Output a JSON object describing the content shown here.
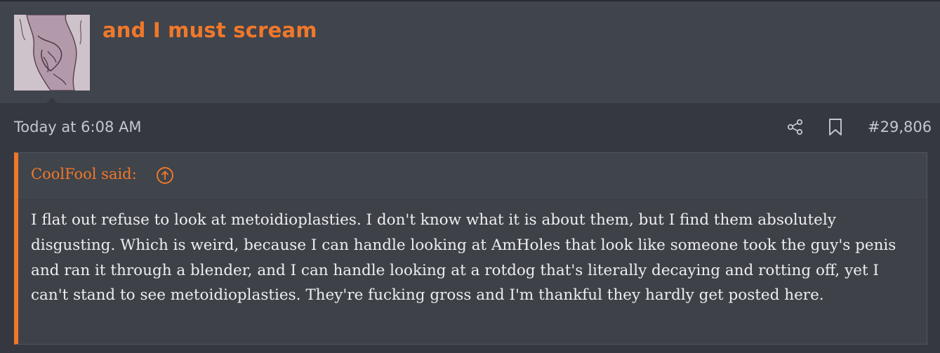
{
  "post": {
    "username": "and I must scream",
    "timestamp": "Today at 6:08 AM",
    "post_number": "#29,806",
    "icons": {
      "share": "share-icon",
      "bookmark": "bookmark-icon",
      "quote_jump": "arrow-up-circle-icon"
    }
  },
  "quote": {
    "author_label": "CoolFool said:",
    "body": "I flat out refuse to look at metoidioplasties. I don't know what it is about them, but I find them absolutely disgusting. Which is weird, because I can handle looking at AmHoles that look like someone took the guy's penis and ran it through a blender, and I can handle looking at a rotdog that's literally decaying and rotting off, yet I can't stand to see metoidioplasties. They're fucking gross and I'm thankful they hardly get posted here."
  },
  "colors": {
    "accent": "#f0782a",
    "background": "#353840",
    "header_background": "#40444c",
    "text": "#eceef0",
    "muted_text": "#c4c7cc"
  }
}
